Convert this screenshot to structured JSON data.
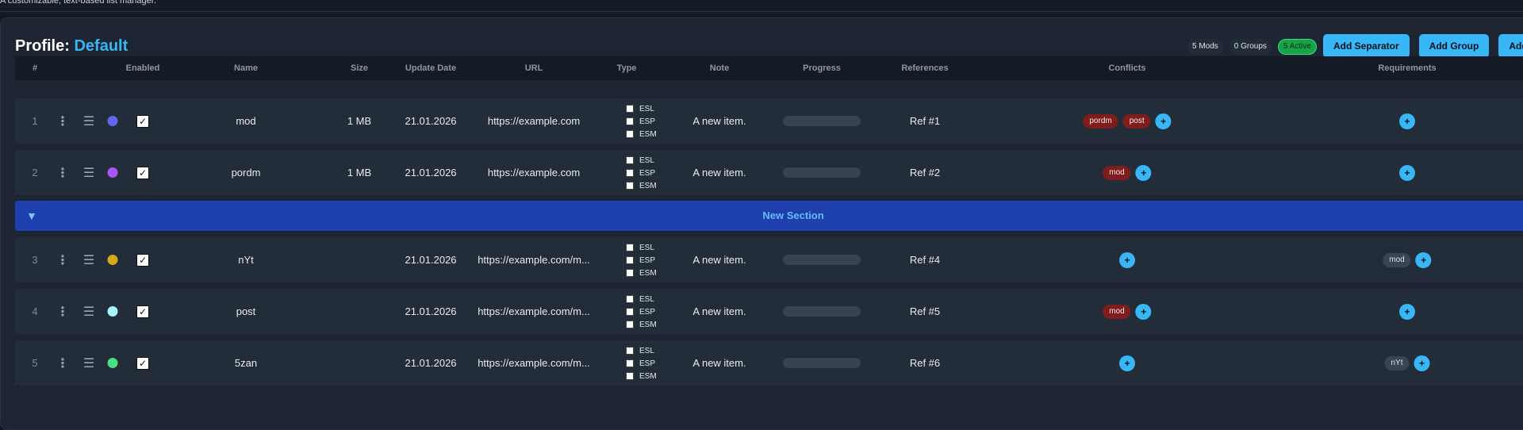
{
  "app": {
    "description": "A customizable, text-based list manager."
  },
  "profile": {
    "label": "Profile:",
    "name": "Default"
  },
  "stats": {
    "mods": "5 Mods",
    "groups": "0 Groups",
    "active": "5 Active"
  },
  "buttons": {
    "add_separator": "Add Separator",
    "add_group": "Add Group",
    "add_mod": "Add"
  },
  "columns": [
    "#",
    "Enabled",
    "Name",
    "Size",
    "Update Date",
    "URL",
    "Type",
    "Note",
    "Progress",
    "References",
    "Conflicts",
    "Requirements"
  ],
  "type_options": [
    "ESL",
    "ESP",
    "ESM"
  ],
  "icons": {
    "menu": "kebab-icon",
    "drag": "drag-handle-icon",
    "check": "✓",
    "plus": "+",
    "collapse": "▼"
  },
  "section": {
    "label": "New Section"
  },
  "rows_top": [
    {
      "num": "1",
      "color": "#6366f1",
      "name": "mod",
      "size": "1 MB",
      "date": "21.01.2026",
      "url": "https://example.com",
      "note": "A new item.",
      "progress": 0,
      "ref": "Ref #1",
      "conflicts": [
        "pordm",
        "post"
      ],
      "requirements": []
    },
    {
      "num": "2",
      "color": "#a855f7",
      "name": "pordm",
      "size": "1 MB",
      "date": "21.01.2026",
      "url": "https://example.com",
      "note": "A new item.",
      "progress": 0,
      "ref": "Ref #2",
      "conflicts": [
        "mod"
      ],
      "requirements": []
    }
  ],
  "rows_bottom": [
    {
      "num": "3",
      "color": "#d4a91a",
      "name": "nYt",
      "size": "",
      "date": "21.01.2026",
      "url": "https://example.com/m...",
      "note": "A new item.",
      "progress": 0,
      "ref": "Ref #4",
      "conflicts": [],
      "requirements": [
        "mod"
      ]
    },
    {
      "num": "4",
      "color": "#a5f3fc",
      "name": "post",
      "size": "",
      "date": "21.01.2026",
      "url": "https://example.com/m...",
      "note": "A new item.",
      "progress": 0,
      "ref": "Ref #5",
      "conflicts": [
        "mod"
      ],
      "requirements": []
    },
    {
      "num": "5",
      "color": "#4ade80",
      "name": "5zan",
      "size": "",
      "date": "21.01.2026",
      "url": "https://example.com/m...",
      "note": "A new item.",
      "progress": 0,
      "ref": "Ref #6",
      "conflicts": [],
      "requirements": [
        "nYt"
      ]
    }
  ],
  "colors": {
    "accent": "#38b6f5",
    "section": "#1e40af",
    "conflict": "#7f1d1d",
    "active": "#16a34a"
  }
}
